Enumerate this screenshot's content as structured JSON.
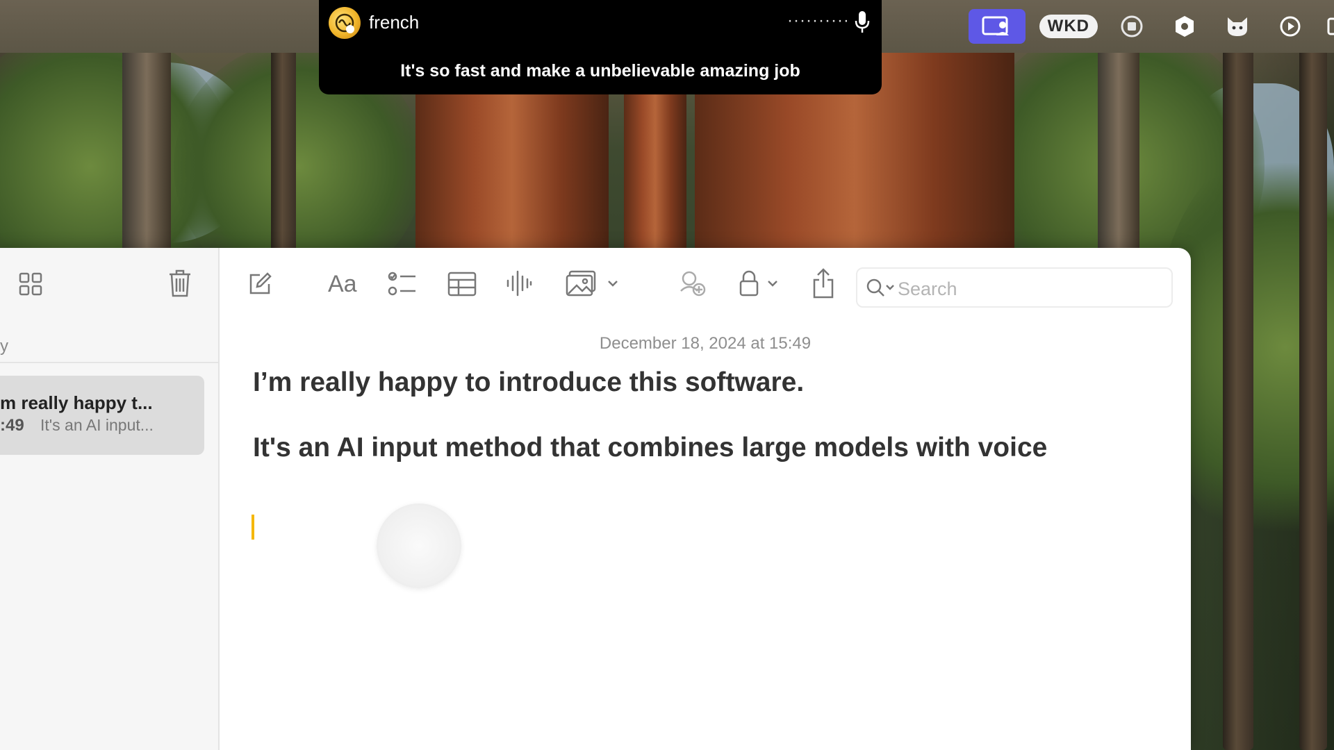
{
  "dictation_hud": {
    "language": "french",
    "waveform": "··········",
    "transcript": "It's so fast and make a unbelievable amazing job",
    "icons": [
      "app-logo-icon",
      "microphone-icon"
    ]
  },
  "menubar": {
    "status_items": [
      "screen-share-icon",
      "WKD",
      "stop-record-icon",
      "shield-icon",
      "cat-icon",
      "play-icon"
    ],
    "wkd_label": "WKD"
  },
  "sidebar": {
    "partial_header": "y",
    "toolbar_icons": [
      "grid-view-icon",
      "trash-icon"
    ],
    "notes": [
      {
        "title": "m really happy t...",
        "time": ":49",
        "snippet": "It's an AI input..."
      }
    ]
  },
  "editor_toolbar": {
    "icons": [
      "compose-icon",
      "format-text-icon",
      "checklist-icon",
      "table-icon",
      "audio-icon",
      "media-icon",
      "collaborate-icon",
      "lock-icon",
      "share-icon"
    ],
    "format_label": "Aa",
    "search": {
      "placeholder": "Search"
    }
  },
  "note": {
    "date": "December 18, 2024 at 15:49",
    "heading": "I’m really happy to introduce this software.",
    "body": "It's an AI input method that combines large models with voice"
  },
  "colors": {
    "accent_purple": "#5e58e6",
    "caret": "#f5b700",
    "hud_bg": "#000000"
  }
}
